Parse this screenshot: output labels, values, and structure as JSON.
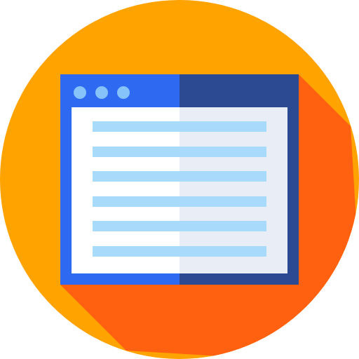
{
  "icon": {
    "name": "browser-window-icon",
    "colors": {
      "circle": "#FFA300",
      "long_shadow": "#FF6110",
      "window_frame_left": "#2E6AF1",
      "window_frame_right": "#2B4A91",
      "content_left": "#FFFFFF",
      "content_right": "#E9EDF5",
      "window_dot": "#87C3FB",
      "text_line": "#A8DAFC"
    },
    "window_dots": [
      "dot",
      "dot",
      "dot"
    ],
    "text_lines_count": 6
  }
}
